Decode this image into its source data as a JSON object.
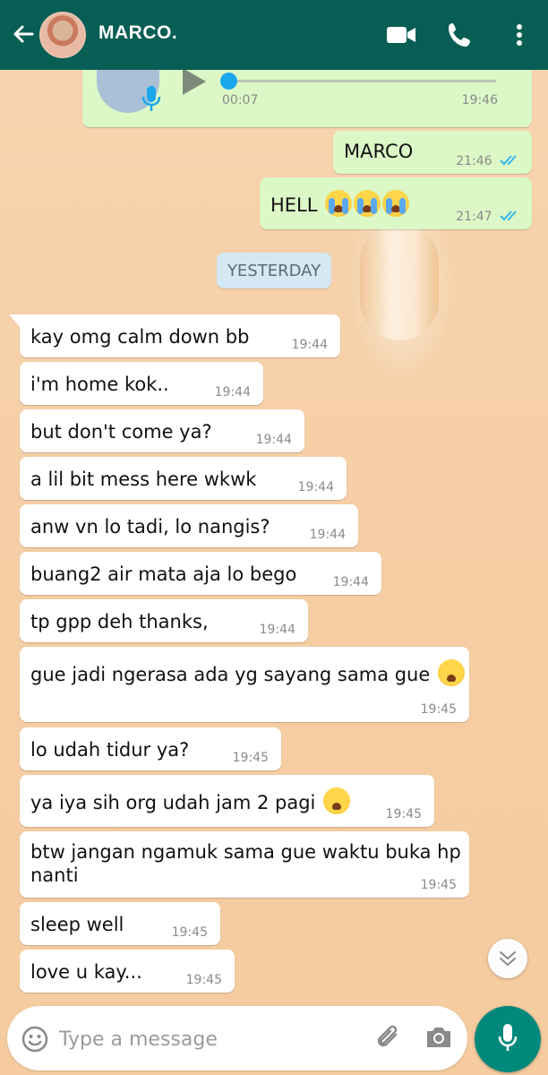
{
  "header": {
    "contact_name": "MARCO.",
    "back_icon": "arrow-left-icon",
    "video_icon": "video-camera-icon",
    "call_icon": "phone-icon",
    "menu_icon": "more-vert-icon",
    "color": "#075e54"
  },
  "voice_note": {
    "duration": "00:07",
    "time": "19:46"
  },
  "outgoing": [
    {
      "text": "MARCO",
      "time": "21:46"
    },
    {
      "text": "HELL",
      "time": "21:47"
    }
  ],
  "date_chip": "YESTERDAY",
  "incoming": [
    {
      "text": "kay omg calm down bb",
      "time": "19:44"
    },
    {
      "text": "i'm home kok..",
      "time": "19:44"
    },
    {
      "text": "but don't come ya?",
      "time": "19:44"
    },
    {
      "text": "a lil bit mess here wkwk",
      "time": "19:44"
    },
    {
      "text": "anw vn lo tadi, lo nangis?",
      "time": "19:44"
    },
    {
      "text": "buang2 air mata aja lo bego",
      "time": "19:44"
    },
    {
      "text": "tp gpp deh thanks,",
      "time": "19:44"
    },
    {
      "text": "gue jadi ngerasa ada yg sayang sama gue",
      "time": "19:45"
    },
    {
      "text": "lo udah tidur ya?",
      "time": "19:45"
    },
    {
      "text": "ya iya sih org udah jam 2 pagi",
      "time": "19:45"
    },
    {
      "text_line1": "btw jangan ngamuk sama gue waktu buka hp",
      "text_line2": "nanti",
      "time": "19:45"
    },
    {
      "text": "sleep well",
      "time": "19:45"
    },
    {
      "text": "love u kay...",
      "time": "19:45"
    }
  ],
  "composer": {
    "placeholder": "Type a message",
    "emoji_icon": "smiley-icon",
    "attach_icon": "paperclip-icon",
    "camera_icon": "camera-icon",
    "mic_icon": "microphone-icon"
  },
  "colors": {
    "outgoing_bubble": "#dcf8c6",
    "incoming_bubble": "#ffffff",
    "read_ticks": "#34b7f1",
    "mic_button": "#00897b"
  }
}
